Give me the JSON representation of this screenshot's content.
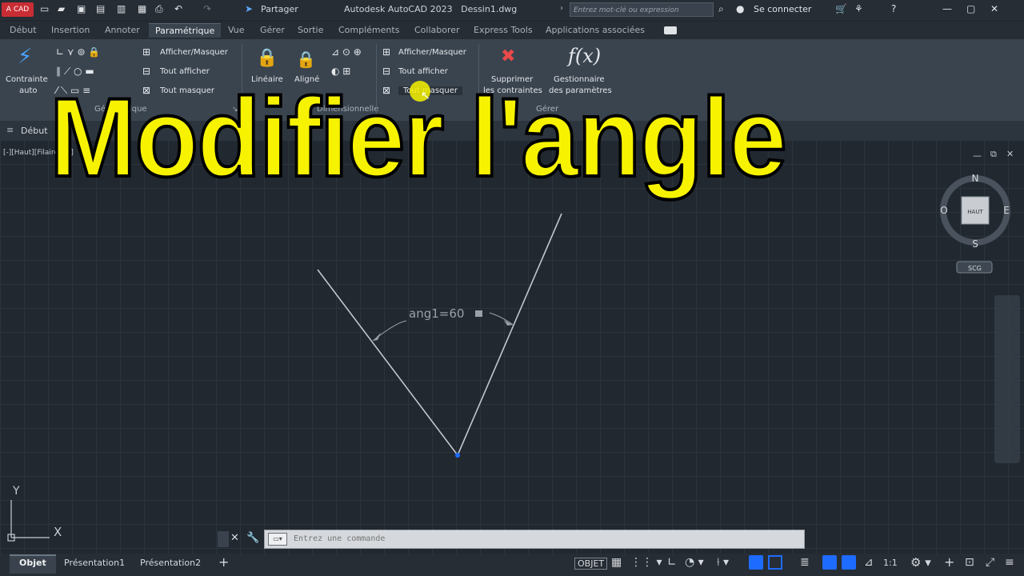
{
  "titlebar": {
    "app_badge": "A CAD",
    "share_label": "Partager",
    "app_title": "Autodesk AutoCAD 2023",
    "file_name": "Dessin1.dwg",
    "search_placeholder": "Entrez mot-clé ou expression",
    "signin_label": "Se connecter"
  },
  "tabs": [
    "Début",
    "Insertion",
    "Annoter",
    "Paramétrique",
    "Vue",
    "Gérer",
    "Sortie",
    "Compléments",
    "Collaborer",
    "Express Tools",
    "Applications associées"
  ],
  "active_tab": "Paramétrique",
  "ribbon": {
    "auto_constraint": [
      "Contrainte",
      "auto"
    ],
    "geo_show_hide": "Afficher/Masquer",
    "geo_show_all": "Tout afficher",
    "geo_hide_all": "Tout masquer",
    "linear": "Linéaire",
    "aligned": "Aligné",
    "dim_panel": "Dimensionnelle",
    "dim_show_hide": "Afficher/Masquer",
    "dim_show_all": "Tout afficher",
    "dim_hide_all": "Tout masquer",
    "delete_constraints": [
      "Supprimer",
      "les contraintes"
    ],
    "param_manager": [
      "Gestionnaire",
      "des paramètres"
    ],
    "manage_panel": "Gérer",
    "geometric_panel": "Géométrique"
  },
  "filetab": "Début",
  "viewport_label": "[-][Haut][Filaire 2D]",
  "overlay_title": "Modifier l'angle",
  "dimension_label": "ang1=60",
  "viewcube": {
    "n": "N",
    "s": "S",
    "e": "E",
    "w": "O",
    "face": "HAUT",
    "ucs": "SCG"
  },
  "ucs_axes": {
    "y": "Y",
    "x": "X"
  },
  "command": {
    "placeholder": "Entrez une commande"
  },
  "layout_tabs": [
    "Objet",
    "Présentation1",
    "Présentation2"
  ],
  "status": {
    "mode": "OBJET",
    "scale": "1:1"
  },
  "colors": {
    "overlay": "#f7f300",
    "badge": "#c92d34",
    "point": "#1e6bff"
  }
}
